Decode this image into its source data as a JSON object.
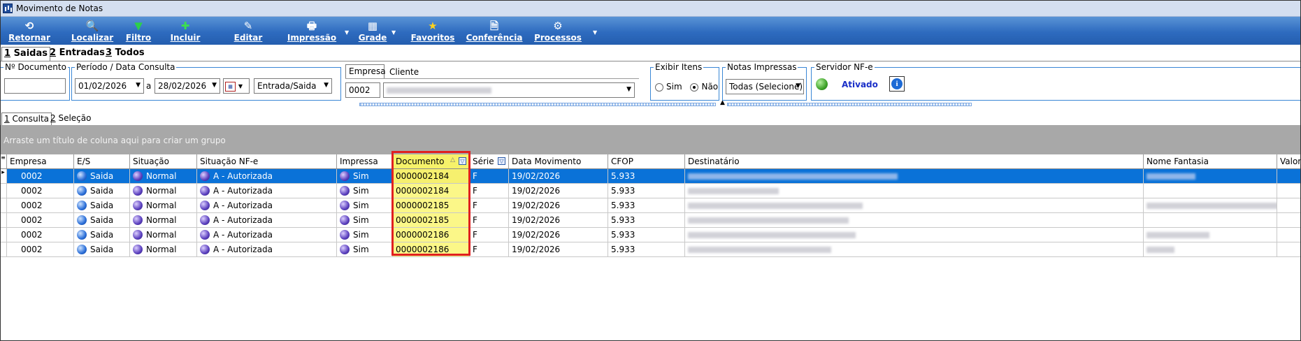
{
  "window": {
    "title": "Movimento de Notas"
  },
  "toolbar": {
    "buttons": [
      {
        "label": "Retornar",
        "icon": "return-arrow-icon",
        "glyph": "⟲"
      },
      {
        "label": "Localizar",
        "icon": "search-icon",
        "glyph": "🔍"
      },
      {
        "label": "Filtro",
        "icon": "filter-funnel-icon",
        "glyph": "▼"
      },
      {
        "label": "Incluir",
        "icon": "plus-icon",
        "glyph": "✚"
      },
      {
        "label": "Editar",
        "icon": "edit-document-icon",
        "glyph": "✎"
      },
      {
        "label": "Impressão",
        "icon": "printer-icon",
        "glyph": "🖶"
      },
      {
        "label": "Grade",
        "icon": "grid-icon",
        "glyph": "▦"
      },
      {
        "label": "Favoritos",
        "icon": "star-icon",
        "glyph": "★"
      },
      {
        "label": "Conferência",
        "icon": "document-check-icon",
        "glyph": "🗎"
      },
      {
        "label": "Processos",
        "icon": "gear-icon",
        "glyph": "⚙"
      }
    ]
  },
  "main_tabs": [
    {
      "num": "1",
      "label": " Saidas",
      "active": true
    },
    {
      "num": "2",
      "label": " Entradas",
      "active": false
    },
    {
      "num": "3",
      "label": " Todos",
      "active": false
    }
  ],
  "filters": {
    "doc_number": {
      "title": "Nº Documento",
      "value": ""
    },
    "period": {
      "title": "Período / Data Consulta",
      "start": "01/02/2026",
      "separator": "a",
      "end": "28/02/2026",
      "type": "Entrada/Saida"
    },
    "empresa": {
      "tab_label": "Empresa",
      "value": "0002"
    },
    "cliente": {
      "tab_label": "Cliente"
    },
    "exibir_itens": {
      "title": "Exibir Itens",
      "opt_sim": "Sim",
      "opt_nao": "Não",
      "selected": "Não"
    },
    "notas_impressas": {
      "title": "Notas Impressas",
      "value": "Todas (Selecione)"
    },
    "servidor": {
      "title": "Servidor NF-e",
      "status": "Ativado"
    }
  },
  "sub_tabs": [
    {
      "num": "1",
      "label": " Consulta",
      "active": true
    },
    {
      "num": "2",
      "label": " Seleção",
      "active": false
    }
  ],
  "groupby_hint": "Arraste um título de coluna aqui para criar um grupo",
  "grid": {
    "columns": [
      "Empresa",
      "E/S",
      "Situação",
      "Situação NF-e",
      "Impressa",
      "Documento",
      "Série",
      "Data Movimento",
      "CFOP",
      "Destinatário",
      "Nome Fantasia",
      "Valor"
    ],
    "rows": [
      {
        "empresa": "0002",
        "es": "Saida",
        "situacao": "Normal",
        "sit_nfe": "A - Autorizada",
        "impressa": "Sim",
        "documento": "0000002184",
        "serie": "F",
        "data": "19/02/2026",
        "cfop": "5.933"
      },
      {
        "empresa": "0002",
        "es": "Saida",
        "situacao": "Normal",
        "sit_nfe": "A - Autorizada",
        "impressa": "Sim",
        "documento": "0000002184",
        "serie": "F",
        "data": "19/02/2026",
        "cfop": "5.933"
      },
      {
        "empresa": "0002",
        "es": "Saida",
        "situacao": "Normal",
        "sit_nfe": "A - Autorizada",
        "impressa": "Sim",
        "documento": "0000002185",
        "serie": "F",
        "data": "19/02/2026",
        "cfop": "5.933"
      },
      {
        "empresa": "0002",
        "es": "Saida",
        "situacao": "Normal",
        "sit_nfe": "A - Autorizada",
        "impressa": "Sim",
        "documento": "0000002185",
        "serie": "F",
        "data": "19/02/2026",
        "cfop": "5.933"
      },
      {
        "empresa": "0002",
        "es": "Saida",
        "situacao": "Normal",
        "sit_nfe": "A - Autorizada",
        "impressa": "Sim",
        "documento": "0000002186",
        "serie": "F",
        "data": "19/02/2026",
        "cfop": "5.933"
      },
      {
        "empresa": "0002",
        "es": "Saida",
        "situacao": "Normal",
        "sit_nfe": "A - Autorizada",
        "impressa": "Sim",
        "documento": "0000002186",
        "serie": "F",
        "data": "19/02/2026",
        "cfop": "5.933"
      }
    ]
  },
  "colors": {
    "toolbar": "#2e6bbf",
    "group_border": "#3a87d6",
    "selected_row": "#0a72d8",
    "doc_highlight": "#fbf788",
    "annotation": "#e02020",
    "status_text": "#1a2fc8"
  }
}
